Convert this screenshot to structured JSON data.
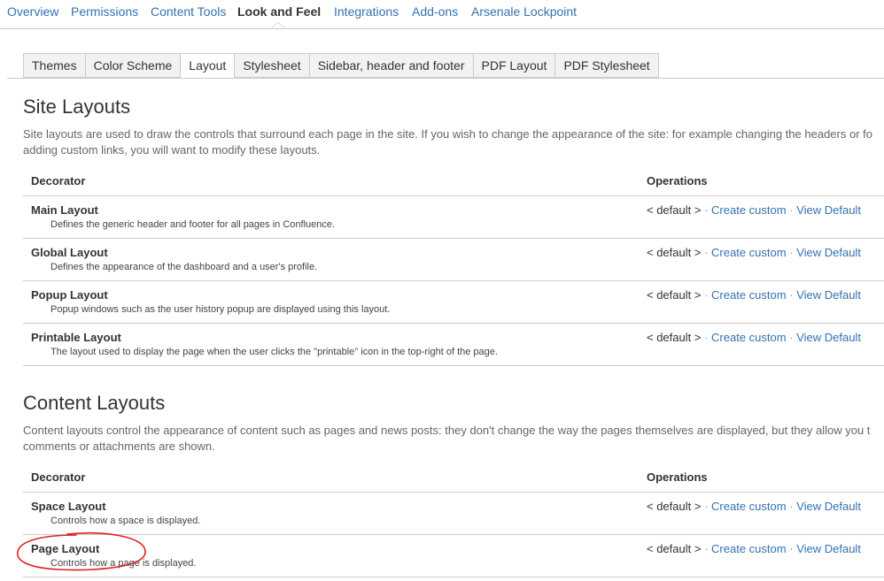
{
  "top_nav": {
    "items": [
      "Overview",
      "Permissions",
      "Content Tools",
      "Look and Feel",
      "Integrations",
      "Add-ons",
      "Arsenale Lockpoint"
    ],
    "active": "Look and Feel"
  },
  "tabs": {
    "items": [
      "Themes",
      "Color Scheme",
      "Layout",
      "Stylesheet",
      "Sidebar, header and footer",
      "PDF Layout",
      "PDF Stylesheet"
    ],
    "active": "Layout"
  },
  "site_layouts": {
    "title": "Site Layouts",
    "description_line1": "Site layouts are used to draw the controls that surround each page in the site. If you wish to change the appearance of the site: for example changing the headers or fo",
    "description_line2": "adding custom links, you will want to modify these layouts.",
    "col_decorator": "Decorator",
    "col_operations": "Operations",
    "rows": [
      {
        "name": "Main Layout",
        "desc": "Defines the generic header and footer for all pages in Confluence.",
        "default": "< default >",
        "create": "Create custom",
        "view": "View Default"
      },
      {
        "name": "Global Layout",
        "desc": "Defines the appearance of the dashboard and a user's profile.",
        "default": "< default >",
        "create": "Create custom",
        "view": "View Default"
      },
      {
        "name": "Popup Layout",
        "desc": "Popup windows such as the user history popup are displayed using this layout.",
        "default": "< default >",
        "create": "Create custom",
        "view": "View Default"
      },
      {
        "name": "Printable Layout",
        "desc": "The layout used to display the page when the user clicks the \"printable\" icon in the top-right of the page.",
        "default": "< default >",
        "create": "Create custom",
        "view": "View Default"
      }
    ]
  },
  "content_layouts": {
    "title": "Content Layouts",
    "description_line1": "Content layouts control the appearance of content such as pages and news posts: they don't change the way the pages themselves are displayed, but they allow you t",
    "description_line2": "comments or attachments are shown.",
    "col_decorator": "Decorator",
    "col_operations": "Operations",
    "rows": [
      {
        "name": "Space Layout",
        "desc": "Controls how a space is displayed.",
        "default": "< default >",
        "create": "Create custom",
        "view": "View Default"
      },
      {
        "name": "Page Layout",
        "desc": "Controls how a page is displayed.",
        "default": "< default >",
        "create": "Create custom",
        "view": "View Default"
      }
    ]
  },
  "separator": "·",
  "annotation_color": "#e02020"
}
